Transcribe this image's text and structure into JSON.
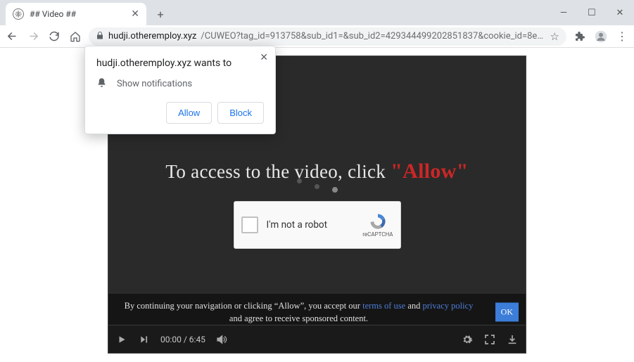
{
  "window": {
    "tab_title": "## Video ##"
  },
  "omnibox": {
    "host": "hudji.otheremploy.xyz",
    "path": "/CUWEO?tag_id=913758&sub_id1=&sub_id2=429344499202851837&cookie_id=8ee50581-728..."
  },
  "permission_popup": {
    "title": "hudji.otheremploy.xyz wants to",
    "line": "Show notifications",
    "allow_label": "Allow",
    "block_label": "Block"
  },
  "page": {
    "headline_prefix": "To access to the video, click ",
    "headline_allow": "\"Allow\"",
    "recaptcha_label": "I'm not a robot",
    "recaptcha_brand": "reCAPTCHA"
  },
  "cookie_banner": {
    "part1": "By continuing your navigation or clicking “Allow”, you accept our ",
    "terms_link": "terms of use",
    "part2": " and ",
    "privacy_link": "privacy policy",
    "part3": " and agree to receive sponsored content.",
    "ok_label": "OK"
  },
  "video_controls": {
    "time": "00:00 / 6:45"
  }
}
